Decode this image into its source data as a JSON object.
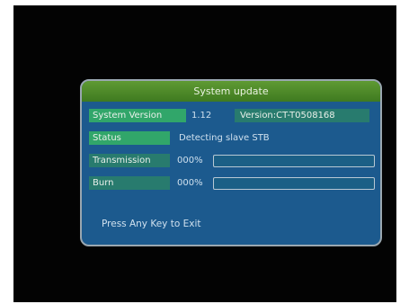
{
  "dialog": {
    "title": "System update",
    "system_version": {
      "label": "System Version",
      "value": "1.12",
      "version_text": "Version:CT-T0508168"
    },
    "status": {
      "label": "Status",
      "value": "Detecting slave STB"
    },
    "transmission": {
      "label": "Transmission",
      "percent_text": "000%",
      "progress": 0
    },
    "burn": {
      "label": "Burn",
      "percent_text": "000%",
      "progress": 0
    },
    "hint": "Press Any Key to Exit"
  },
  "colors": {
    "title_bar": "#4d8a2a",
    "panel": "#1c5a8e",
    "label_bg": "#287b6e",
    "selected_label_bg": "#31a66a",
    "screen": "#030303"
  }
}
